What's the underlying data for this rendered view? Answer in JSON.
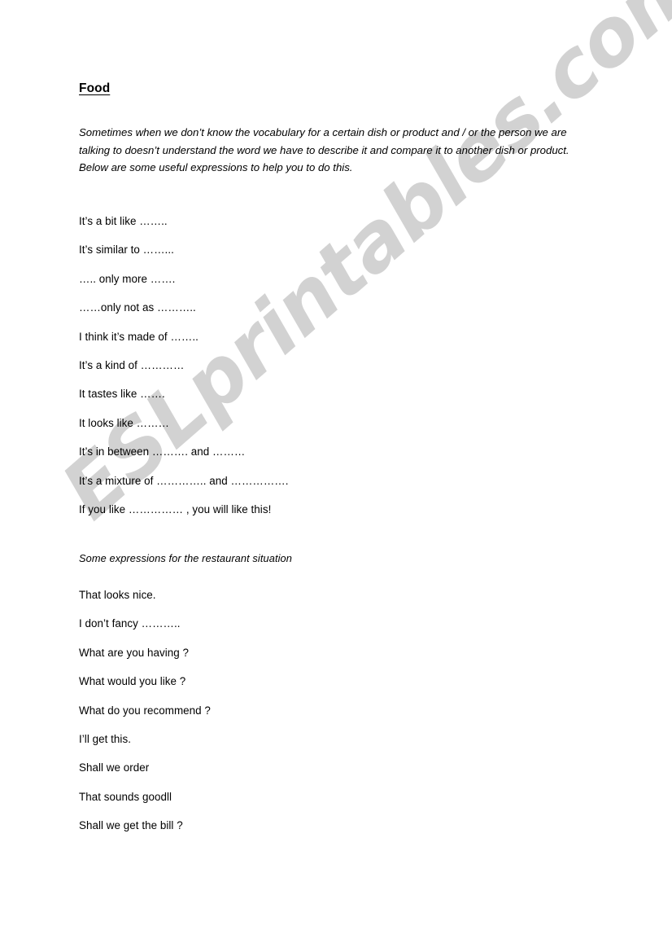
{
  "document": {
    "title": "Food",
    "intro_paragraph": "Sometimes when we don’t know the vocabulary for a certain dish or product  and / or the person we are talking to doesn’t understand the word we have to describe it and compare it to another dish or product. Below are some useful expressions to help you to do this.",
    "comparison_expressions": [
      "It’s a bit like ……..",
      "It’s similar to ……...",
      "….. only more …….",
      "……only not as ………..",
      "I think it’s made of ……..",
      "It’s a kind of …………",
      "It tastes like …….",
      "It looks like ………",
      "It’s in between ………. and ………",
      "It’s a mixture of ………….. and …………….",
      "If you like …………… , you will like this!"
    ],
    "restaurant_section_heading": "Some expressions for the restaurant situation",
    "restaurant_expressions": [
      "That looks nice.",
      "I don’t fancy ………..",
      "What are you having ?",
      "What would you like ?",
      "What do you recommend ?",
      "I’ll get this.",
      "Shall we order",
      "That sounds goodll",
      "Shall we get the bill ?"
    ]
  },
  "watermark": {
    "text": "ESLprintables.com",
    "color": "#d2d2d2"
  }
}
